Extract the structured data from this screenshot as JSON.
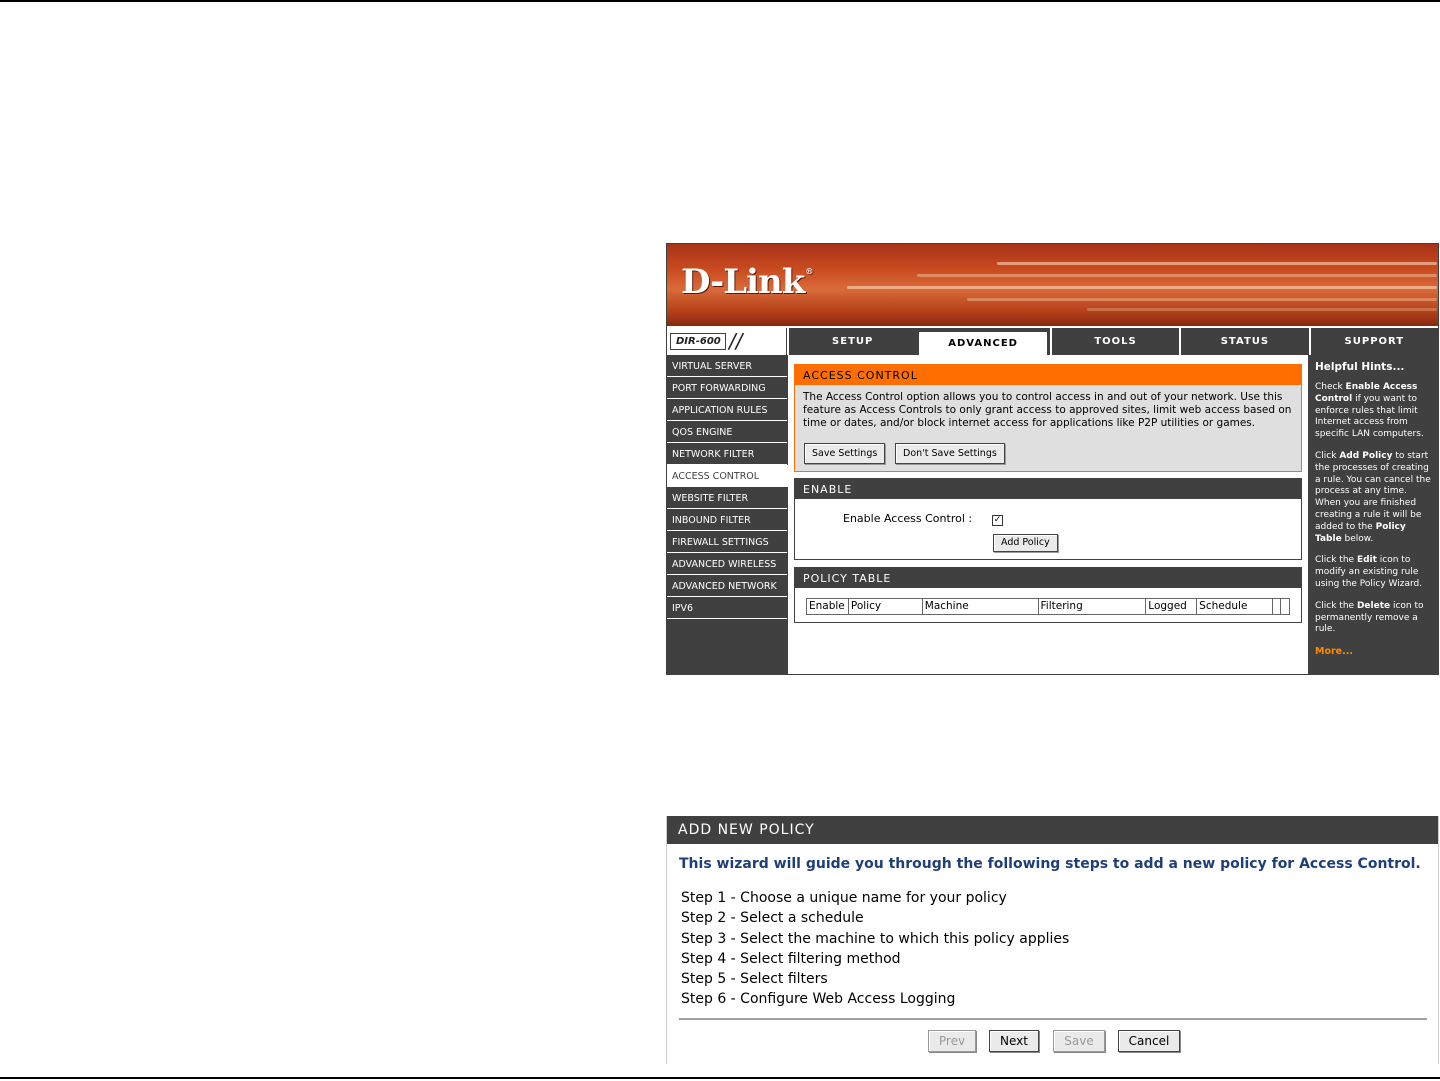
{
  "router": {
    "brand": "D-Link",
    "model": "DIR-600",
    "tabs": [
      {
        "label": "SETUP"
      },
      {
        "label": "ADVANCED"
      },
      {
        "label": "TOOLS"
      },
      {
        "label": "STATUS"
      },
      {
        "label": "SUPPORT"
      }
    ],
    "active_tab": "ADVANCED",
    "sidebar": [
      {
        "label": "VIRTUAL SERVER"
      },
      {
        "label": "PORT FORWARDING"
      },
      {
        "label": "APPLICATION RULES"
      },
      {
        "label": "QOS ENGINE"
      },
      {
        "label": "NETWORK FILTER"
      },
      {
        "label": "ACCESS CONTROL"
      },
      {
        "label": "WEBSITE FILTER"
      },
      {
        "label": "INBOUND FILTER"
      },
      {
        "label": "FIREWALL SETTINGS"
      },
      {
        "label": "ADVANCED WIRELESS"
      },
      {
        "label": "ADVANCED NETWORK"
      },
      {
        "label": "IPV6"
      }
    ],
    "active_sidebar": "ACCESS CONTROL",
    "access_control": {
      "title": "ACCESS CONTROL",
      "description": "The Access Control option allows you to control access in and out of your network. Use this feature as Access Controls to only grant access to approved sites, limit web access based on time or dates, and/or block internet access for applications like P2P utilities or games.",
      "save_label": "Save Settings",
      "dont_save_label": "Don't Save Settings"
    },
    "enable": {
      "title": "ENABLE",
      "label": "Enable Access Control :",
      "checked": true,
      "check_mark": "✓",
      "add_policy_label": "Add Policy"
    },
    "policy_table": {
      "title": "POLICY TABLE",
      "columns": [
        "Enable",
        "Policy",
        "Machine",
        "Filtering",
        "Logged",
        "Schedule"
      ]
    },
    "hints": {
      "title": "Helpful Hints...",
      "more": "More...",
      "h1": {
        "a": "Check ",
        "b": "Enable Access Control",
        "c": " if you want to enforce rules that limit Internet access from specific LAN computers."
      },
      "h2": {
        "a": "Click ",
        "b": "Add Policy",
        "c": " to start the processes of creating a rule. You can cancel the process at any time. When you are finished creating a rule it will be added to the ",
        "d": "Policy Table",
        "e": " below."
      },
      "h3": {
        "a": "Click the ",
        "b": "Edit",
        "c": " icon to modify an existing rule using the Policy Wizard."
      },
      "h4": {
        "a": "Click the ",
        "b": "Delete",
        "c": " icon to permanently remove a rule."
      }
    }
  },
  "wizard": {
    "title": "ADD NEW POLICY",
    "intro": "This wizard will guide you through the following steps to add a new policy for Access Control.",
    "steps": [
      "Step 1 - Choose a unique name for your policy",
      "Step 2 - Select a schedule",
      "Step 3 - Select the machine to which this policy applies",
      "Step 4 - Select filtering method",
      "Step 5 - Select filters",
      "Step 6 - Configure Web Access Logging"
    ],
    "buttons": {
      "prev": "Prev",
      "next": "Next",
      "save": "Save",
      "cancel": "Cancel"
    }
  },
  "colors": {
    "accent_orange": "#ff6f00",
    "nav_dark": "#404040",
    "intro_blue": "#1f3f7a",
    "more_orange": "#ff8c00"
  }
}
